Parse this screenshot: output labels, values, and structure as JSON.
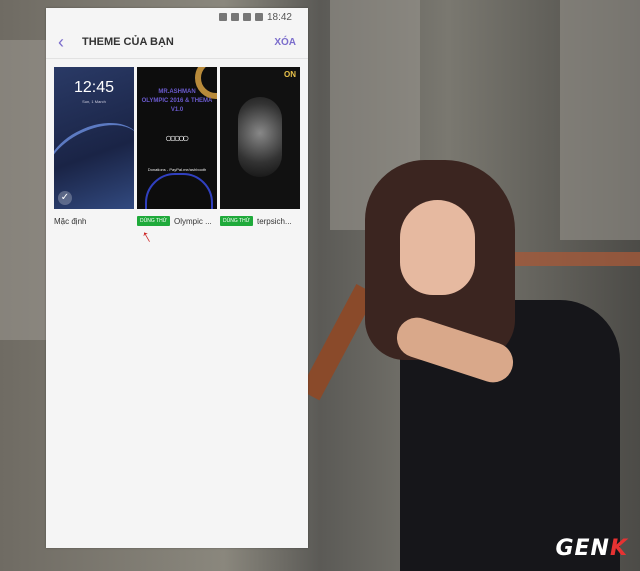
{
  "status_bar": {
    "time": "18:42"
  },
  "header": {
    "back_icon": "back-arrow-icon",
    "title": "THEME CỦA BẠN",
    "action_label": "XÓA"
  },
  "themes": [
    {
      "name": "Mặc định",
      "badge": "",
      "preview_time": "12:45",
      "preview_date": "Sun, 1 March"
    },
    {
      "name": "Olympic ...",
      "badge": "DÙNG THỬ",
      "preview_text": [
        "MR.ASHMAN",
        "OLYMPIC 2016 & THEMA",
        "V1.0"
      ],
      "preview_donate": "Donations - PayPal.me/ashbooth"
    },
    {
      "name": "terpsich...",
      "badge": "DÙNG THỬ",
      "preview_mark": "ON"
    }
  ],
  "watermark": {
    "main": "GEN",
    "accent": "K"
  },
  "colors": {
    "accent": "#7b6dcc",
    "badge": "#1faa3b",
    "annotation": "#cc2222"
  }
}
